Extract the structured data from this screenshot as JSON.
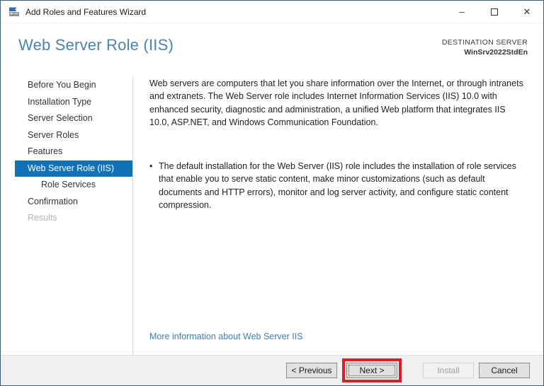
{
  "window": {
    "title": "Add Roles and Features Wizard",
    "controls": {
      "minimize": "–",
      "close": "✕"
    }
  },
  "header": {
    "title": "Web Server Role (IIS)",
    "destination_label": "DESTINATION SERVER",
    "destination_server": "WinSrv2022StdEn"
  },
  "sidebar": {
    "items": [
      {
        "label": "Before You Begin",
        "state": "normal"
      },
      {
        "label": "Installation Type",
        "state": "normal"
      },
      {
        "label": "Server Selection",
        "state": "normal"
      },
      {
        "label": "Server Roles",
        "state": "normal"
      },
      {
        "label": "Features",
        "state": "normal"
      },
      {
        "label": "Web Server Role (IIS)",
        "state": "selected"
      },
      {
        "label": "Role Services",
        "state": "child"
      },
      {
        "label": "Confirmation",
        "state": "normal"
      },
      {
        "label": "Results",
        "state": "disabled"
      }
    ]
  },
  "content": {
    "intro": "Web servers are computers that let you share information over the Internet, or through intranets and extranets. The Web Server role includes Internet Information Services (IIS) 10.0 with enhanced security, diagnostic and administration, a unified Web platform that integrates IIS 10.0, ASP.NET, and Windows Communication Foundation.",
    "bullet_glyph": "•",
    "bullet": "The default installation for the Web Server (IIS) role includes the installation of role services that enable you to serve static content, make minor customizations (such as default documents and HTTP errors), monitor and log server activity, and configure static content compression.",
    "link": "More information about Web Server IIS"
  },
  "footer": {
    "previous_label": "< Previous",
    "next_label": "Next >",
    "install_label": "Install",
    "cancel_label": "Cancel"
  },
  "colors": {
    "header_blue": "#4d82ab",
    "nav_selected_blue": "#1272b8",
    "link_blue": "#3f7fae",
    "annotation_red": "#d92027",
    "footer_gray": "#f0f0f0"
  }
}
